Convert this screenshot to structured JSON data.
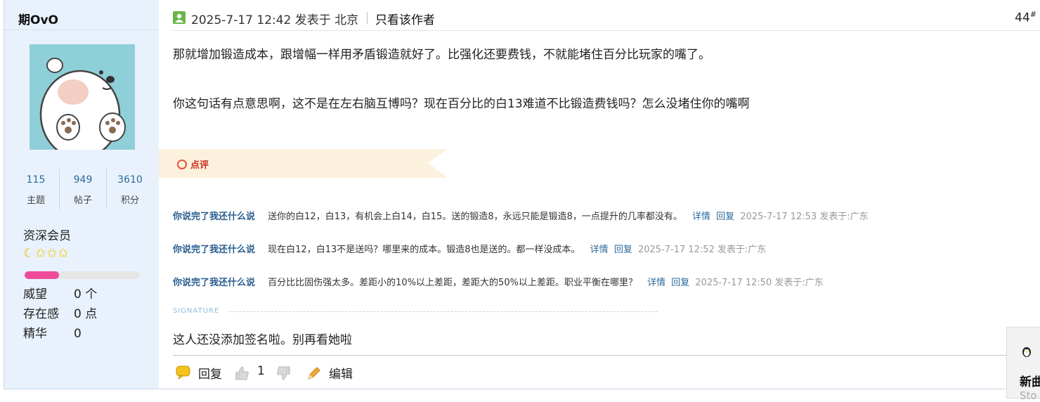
{
  "user": {
    "name": "期OvO",
    "stats": [
      {
        "value": "115",
        "label": "主题"
      },
      {
        "value": "949",
        "label": "帖子"
      },
      {
        "value": "3610",
        "label": "积分"
      }
    ],
    "rank": "资深会员",
    "stars": {
      "moon": "☾",
      "star": "✩✩✩"
    },
    "progress_fraction": 0.3,
    "attributes": [
      {
        "key": "威望",
        "value": "0 个"
      },
      {
        "key": "存在感",
        "value": "0 点"
      },
      {
        "key": "精华",
        "value": "0"
      }
    ]
  },
  "post": {
    "datetime": "2025-7-17 12:42 发表于 北京",
    "only_author": "只看该作者",
    "floor": "44",
    "floor_mark": "#",
    "paragraphs": [
      "那就增加锻造成本，跟增幅一样用矛盾锻造就好了。比强化还要费钱，不就能堵住百分比玩家的嘴了。",
      "你这句话有点意思啊，这不是在左右脑互博吗？现在百分比的白13难道不比锻造费钱吗？怎么没堵住你的嘴啊"
    ],
    "comment_section_label": "点评",
    "comments": [
      {
        "author": "你说完了我还什么说",
        "text": "送你的白12，白13，有机会上白14，白15。送的锻造8，永远只能是锻造8，一点提升的几率都没有。",
        "detail": "详情",
        "reply": "回复",
        "meta": "2025-7-17 12:53 发表于:广东"
      },
      {
        "author": "你说完了我还什么说",
        "text": "现在白12，白13不是送吗？哪里来的成本。锻造8也是送的。都一样没成本。",
        "detail": "详情",
        "reply": "回复",
        "meta": "2025-7-17 12:52 发表于:广东"
      },
      {
        "author": "你说完了我还什么说",
        "text": "百分比比固伤强太多。差距小的10%以上差距，差距大的50%以上差距。职业平衡在哪里？",
        "detail": "详情",
        "reply": "回复",
        "meta": "2025-7-17 12:50 发表于:广东"
      }
    ],
    "signature_label": "SIGNATURE",
    "signature": "这人还没添加签名啦。别再看她啦",
    "actions": {
      "reply": "回复",
      "like_count": "1",
      "edit": "编辑"
    }
  },
  "floating": {
    "title": "新曲",
    "subtitle": "Sto"
  },
  "colors": {
    "sidebar_bg": "#e9f2fc",
    "link": "#2b6a9c",
    "accent_pink": "#ee4c9a",
    "comment_banner": "#fcf1dc"
  }
}
